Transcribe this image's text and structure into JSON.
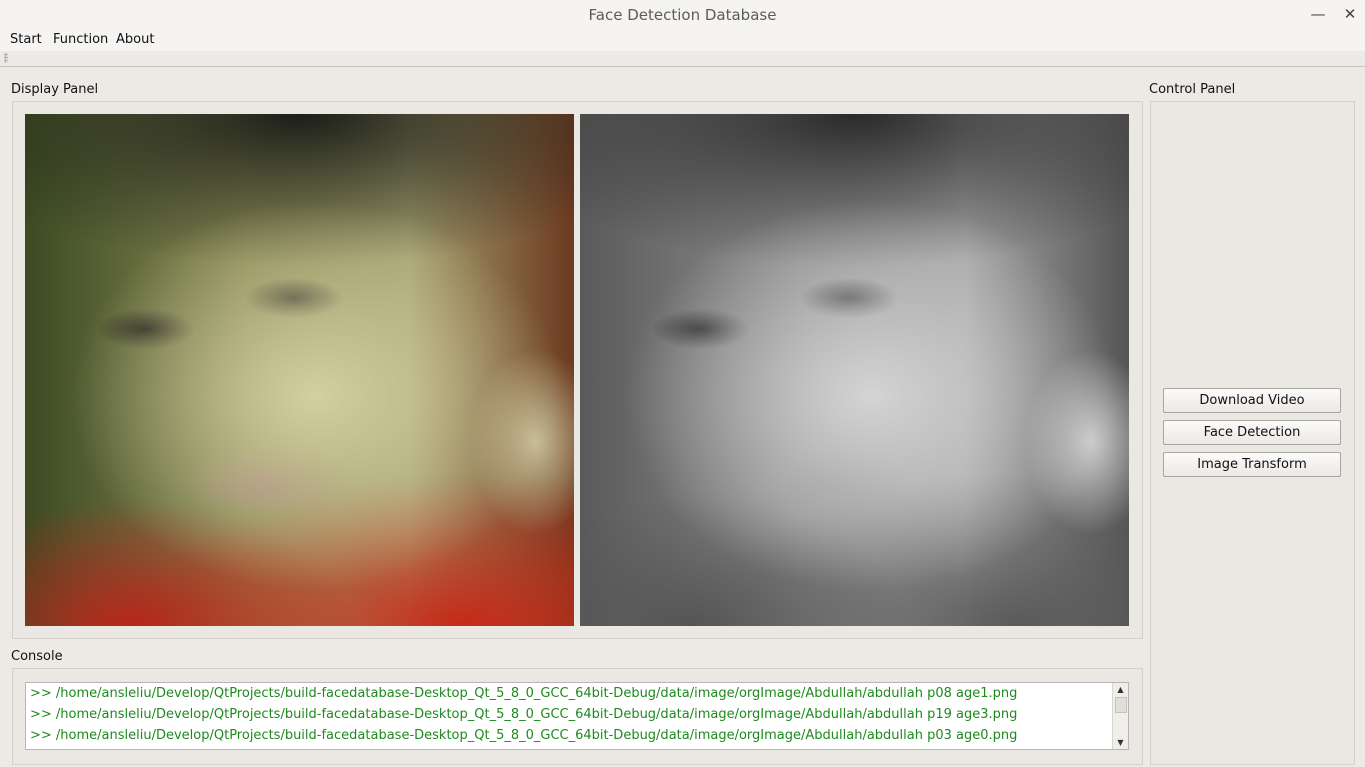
{
  "window": {
    "title": "Face Detection Database"
  },
  "menu": {
    "items": [
      "Start",
      "Function",
      "About"
    ]
  },
  "display_panel": {
    "label": "Display Panel"
  },
  "control_panel": {
    "label": "Control Panel",
    "buttons": [
      "Download Video",
      "Face Detection",
      "Image Transform"
    ]
  },
  "console": {
    "label": "Console",
    "lines": [
      ">> /home/ansleliu/Develop/QtProjects/build-facedatabase-Desktop_Qt_5_8_0_GCC_64bit-Debug/data/image/orgImage/Abdullah/abdullah p08 age1.png",
      ">> /home/ansleliu/Develop/QtProjects/build-facedatabase-Desktop_Qt_5_8_0_GCC_64bit-Debug/data/image/orgImage/Abdullah/abdullah p19 age3.png",
      ">> /home/ansleliu/Develop/QtProjects/build-facedatabase-Desktop_Qt_5_8_0_GCC_64bit-Debug/data/image/orgImage/Abdullah/abdullah p03 age0.png"
    ],
    "text_color": "#1e8a1e"
  }
}
